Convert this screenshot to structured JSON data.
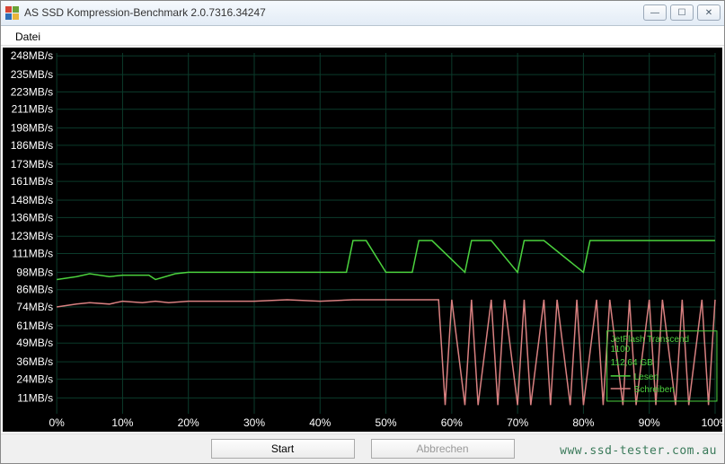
{
  "window": {
    "title": "AS SSD Kompression-Benchmark 2.0.7316.34247"
  },
  "menu": {
    "file": "Datei"
  },
  "buttons": {
    "start": "Start",
    "cancel": "Abbrechen"
  },
  "legend": {
    "device_line1": "JetFlash Transcend",
    "device_line2": "1100",
    "capacity": "112,64 GB",
    "read": "Lesen",
    "write": "Schreiben"
  },
  "watermark": "www.ssd-tester.com.au",
  "chart_data": {
    "type": "line",
    "xlabel": "",
    "ylabel": "",
    "x_unit": "%",
    "y_unit": "MB/s",
    "xlim": [
      0,
      100
    ],
    "ylim": [
      0,
      250
    ],
    "x_ticks": [
      0,
      10,
      20,
      30,
      40,
      50,
      60,
      70,
      80,
      90,
      100
    ],
    "y_ticks": [
      11,
      24,
      36,
      49,
      61,
      74,
      86,
      98,
      111,
      123,
      136,
      148,
      161,
      173,
      186,
      198,
      211,
      223,
      235,
      248
    ],
    "y_tick_labels": [
      "11MB/s",
      "24MB/s",
      "36MB/s",
      "49MB/s",
      "61MB/s",
      "74MB/s",
      "86MB/s",
      "98MB/s",
      "111MB/s",
      "123MB/s",
      "136MB/s",
      "148MB/s",
      "161MB/s",
      "173MB/s",
      "186MB/s",
      "198MB/s",
      "211MB/s",
      "223MB/s",
      "235MB/s",
      "248MB/s"
    ],
    "series": [
      {
        "name": "Lesen",
        "color": "#4bd23e",
        "x": [
          0,
          3,
          5,
          8,
          10,
          14,
          15,
          18,
          20,
          25,
          30,
          35,
          40,
          44,
          45,
          47,
          50,
          54,
          55,
          57,
          62,
          63,
          66,
          70,
          71,
          74,
          80,
          81,
          84,
          100
        ],
        "y": [
          93,
          95,
          97,
          95,
          96,
          96,
          93,
          97,
          98,
          98,
          98,
          98,
          98,
          98,
          120,
          120,
          98,
          98,
          120,
          120,
          98,
          120,
          120,
          98,
          120,
          120,
          98,
          120,
          120,
          120
        ]
      },
      {
        "name": "Schreiben",
        "color": "#d88080",
        "x": [
          0,
          3,
          5,
          8,
          10,
          13,
          15,
          17,
          20,
          25,
          30,
          35,
          40,
          45,
          50,
          55,
          58,
          59,
          60,
          62,
          63,
          64,
          66,
          67,
          68,
          70,
          71,
          72,
          74,
          75,
          76,
          78,
          79,
          80,
          82,
          83,
          84,
          86,
          87,
          88,
          90,
          91,
          92,
          94,
          95,
          96,
          98,
          99,
          100
        ],
        "y": [
          74,
          76,
          77,
          76,
          78,
          77,
          78,
          77,
          78,
          78,
          78,
          79,
          78,
          79,
          79,
          79,
          79,
          6,
          79,
          6,
          79,
          6,
          79,
          6,
          79,
          6,
          79,
          6,
          79,
          6,
          79,
          6,
          79,
          6,
          79,
          6,
          79,
          6,
          79,
          6,
          79,
          6,
          79,
          6,
          79,
          6,
          79,
          6,
          79
        ]
      }
    ]
  }
}
